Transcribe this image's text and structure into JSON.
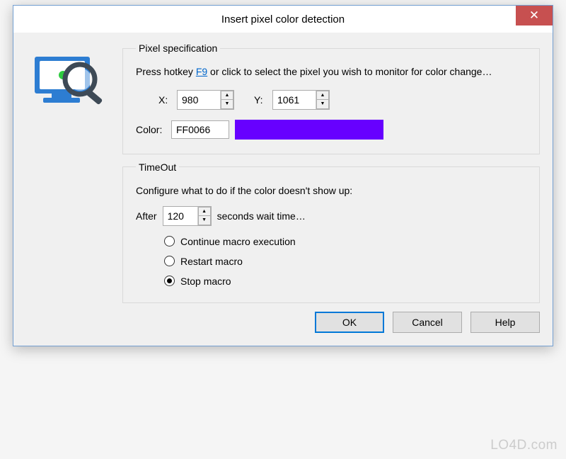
{
  "window": {
    "title": "Insert pixel color detection",
    "close_glyph": "✕"
  },
  "pixel_spec": {
    "legend": "Pixel specification",
    "instruction_pre": "Press hotkey ",
    "hotkey": "F9",
    "instruction_post": " or click to select the pixel you wish to monitor for color change…",
    "x_label": "X:",
    "x_value": "980",
    "y_label": "Y:",
    "y_value": "1061",
    "color_label": "Color:",
    "color_value": "FF0066",
    "swatch_hex": "#6700FF"
  },
  "timeout": {
    "legend": "TimeOut",
    "instruction": "Configure what to do if the color doesn't show up:",
    "after_label": "After",
    "after_value": "120",
    "after_suffix": "seconds wait time…",
    "options": {
      "continue": "Continue macro execution",
      "restart": "Restart macro",
      "stop": "Stop macro"
    },
    "selected": "stop"
  },
  "buttons": {
    "ok": "OK",
    "cancel": "Cancel",
    "help": "Help"
  },
  "watermark": "LO4D.com"
}
